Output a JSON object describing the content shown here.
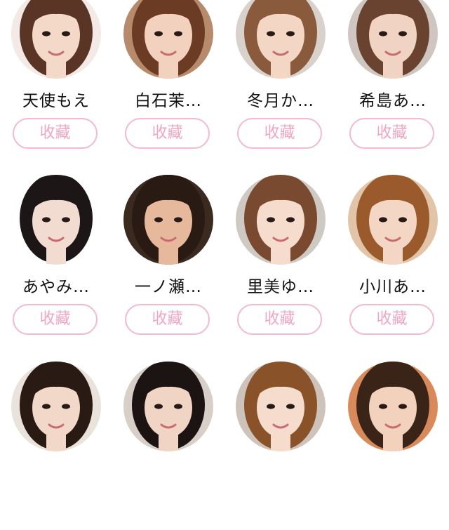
{
  "performers": [
    {
      "name": "天使もえ",
      "button": "收藏",
      "hair": "#5a3526",
      "skin": "#f4d8c8",
      "bg": "#f3e9e6"
    },
    {
      "name": "白石茉…",
      "button": "收藏",
      "hair": "#6b3b24",
      "skin": "#f2d2be",
      "bg": "#b88a6c"
    },
    {
      "name": "冬月か…",
      "button": "收藏",
      "hair": "#8a5a3c",
      "skin": "#f3d6c4",
      "bg": "#d9d2cc"
    },
    {
      "name": "希島あ…",
      "button": "收藏",
      "hair": "#6a4230",
      "skin": "#f1d3c3",
      "bg": "#cfc6c2"
    },
    {
      "name": "あやみ…",
      "button": "收藏",
      "hair": "#1d1616",
      "skin": "#f2dcd2",
      "bg": "#ffffff"
    },
    {
      "name": "一ノ瀬…",
      "button": "收藏",
      "hair": "#2a1a14",
      "skin": "#e6b89c",
      "bg": "#3a2a20"
    },
    {
      "name": "里美ゆ…",
      "button": "收藏",
      "hair": "#7a4a30",
      "skin": "#f5dccd",
      "bg": "#cfc9c4"
    },
    {
      "name": "小川あ…",
      "button": "收藏",
      "hair": "#9a5a2c",
      "skin": "#f4d6c4",
      "bg": "#e2c4a8"
    },
    {
      "name": "",
      "button": "",
      "hair": "#2a1a14",
      "skin": "#f2d8c8",
      "bg": "#e9e3dc"
    },
    {
      "name": "",
      "button": "",
      "hair": "#1c1412",
      "skin": "#f0d4c4",
      "bg": "#d7cfc8"
    },
    {
      "name": "",
      "button": "",
      "hair": "#8a5228",
      "skin": "#f5dccc",
      "bg": "#cdc3ba"
    },
    {
      "name": "",
      "button": "",
      "hair": "#3a2418",
      "skin": "#f2d2bc",
      "bg": "#d98a5a"
    }
  ]
}
